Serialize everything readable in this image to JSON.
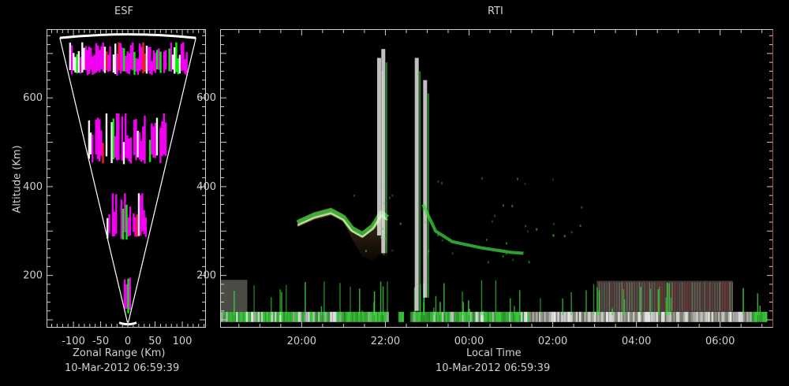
{
  "chart_data": [
    {
      "type": "scatter",
      "title": "ESF",
      "xlabel": "Zonal Range (Km)",
      "ylabel": "Altitude (Km)",
      "timestamp": "10-Mar-2012 06:59:39",
      "xlim": [
        -148,
        142
      ],
      "ylim": [
        84,
        753
      ],
      "x_ticks": [
        -100,
        -50,
        0,
        50,
        100
      ],
      "y_ticks": [
        200,
        400,
        600
      ],
      "grid": false,
      "background": "#000000",
      "wedge_color": "#ffffff",
      "echo_colors": {
        "primary": "#ff00ff",
        "strong": "#ffffff",
        "secondary": "#00ff00",
        "minor": "#ff2020"
      },
      "echo_bands": [
        {
          "alt_min": 650,
          "alt_max": 725,
          "intensity": 0.9
        },
        {
          "alt_min": 450,
          "alt_max": 565,
          "intensity": 0.8
        },
        {
          "alt_min": 280,
          "alt_max": 385,
          "intensity": 0.75
        },
        {
          "alt_min": 110,
          "alt_max": 195,
          "intensity": 0.7
        }
      ]
    },
    {
      "type": "heatmap",
      "title": "RTI",
      "xlabel": "Local Time",
      "timestamp": "10-Mar-2012 06:59:39",
      "x_ticks": [
        "20:00",
        "22:00",
        "00:00",
        "02:00",
        "04:00",
        "06:00"
      ],
      "x_tick_hours": [
        20,
        22,
        24,
        26,
        28,
        30
      ],
      "xlim_hours": [
        18.07,
        31.25
      ],
      "ylim": [
        84,
        753
      ],
      "y_ticks": [
        200,
        400,
        600
      ],
      "grid": false,
      "background": "#000000",
      "echo_colors": {
        "green": "#3fd43f",
        "white": "#f0f0f0",
        "brown": "#7a5a3a",
        "red": "#c83030"
      },
      "plume": [
        {
          "time": 19.9,
          "alt": 318
        },
        {
          "time": 20.3,
          "alt": 335
        },
        {
          "time": 20.7,
          "alt": 345
        },
        {
          "time": 21.0,
          "alt": 330
        },
        {
          "time": 21.2,
          "alt": 305
        },
        {
          "time": 21.45,
          "alt": 292
        },
        {
          "time": 21.7,
          "alt": 310
        },
        {
          "time": 21.9,
          "alt": 340
        },
        {
          "time": 22.05,
          "alt": 330
        }
      ],
      "vertical_streaks": [
        {
          "time": 21.85,
          "alt_min": 290,
          "alt_max": 690
        },
        {
          "time": 21.95,
          "alt_min": 250,
          "alt_max": 710
        },
        {
          "time": 22.75,
          "alt_min": 120,
          "alt_max": 690
        },
        {
          "time": 22.95,
          "alt_min": 150,
          "alt_max": 640
        }
      ],
      "tail": [
        {
          "time": 22.9,
          "alt": 360
        },
        {
          "time": 23.2,
          "alt": 300
        },
        {
          "time": 23.6,
          "alt": 276
        },
        {
          "time": 24.3,
          "alt": 262
        },
        {
          "time": 25.0,
          "alt": 252
        },
        {
          "time": 25.3,
          "alt": 250
        }
      ],
      "low_layer": {
        "alt_min": 95,
        "alt_max": 118
      }
    }
  ]
}
